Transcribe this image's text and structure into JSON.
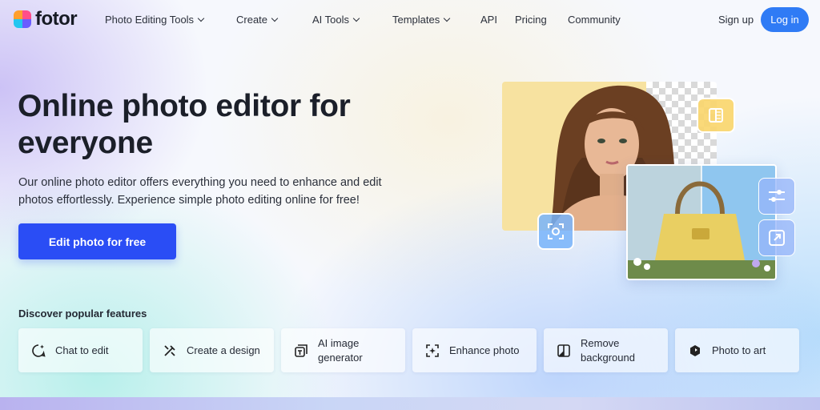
{
  "brand": {
    "name": "fotor"
  },
  "nav": {
    "items": [
      {
        "label": "Photo Editing Tools",
        "has_dropdown": true
      },
      {
        "label": "Create",
        "has_dropdown": true
      },
      {
        "label": "AI Tools",
        "has_dropdown": true
      },
      {
        "label": "Templates",
        "has_dropdown": true
      },
      {
        "label": "API",
        "has_dropdown": false
      },
      {
        "label": "Pricing",
        "has_dropdown": false
      },
      {
        "label": "Community",
        "has_dropdown": false
      }
    ],
    "signup_label": "Sign up",
    "login_label": "Log in"
  },
  "hero": {
    "title": "Online photo editor for everyone",
    "description": "Our online photo editor offers everything you need to enhance and edit photos effortlessly. Experience simple photo editing online for free!",
    "cta_label": "Edit photo for free"
  },
  "features": {
    "heading": "Discover popular features",
    "items": [
      {
        "label": "Chat to edit",
        "icon": "chat-sparkle-icon"
      },
      {
        "label": "Create a design",
        "icon": "design-tools-icon"
      },
      {
        "label": "AI image generator",
        "icon": "ai-image-icon"
      },
      {
        "label": "Enhance photo",
        "icon": "enhance-sparkle-icon"
      },
      {
        "label": "Remove background",
        "icon": "remove-bg-icon"
      },
      {
        "label": "Photo to art",
        "icon": "photo-art-icon"
      }
    ]
  },
  "hero_visual": {
    "tools": [
      "background-cutout-icon",
      "adjust-sliders-icon",
      "resize-icon",
      "focus-icon"
    ]
  },
  "colors": {
    "primary_button": "#2a4df5",
    "login_button": "#2f7bf5",
    "text_dark": "#1b1f29"
  }
}
